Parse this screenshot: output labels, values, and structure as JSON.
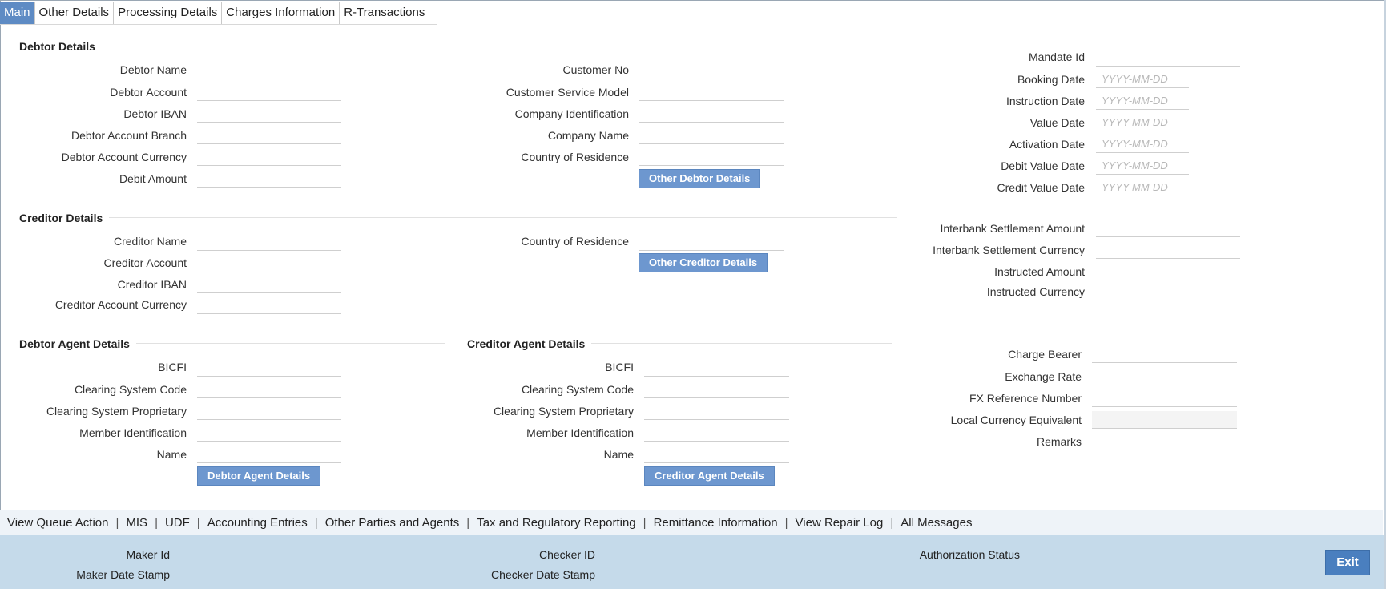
{
  "tabs": [
    "Main",
    "Other Details",
    "Processing Details",
    "Charges Information",
    "R-Transactions"
  ],
  "debtor": {
    "title": "Debtor Details",
    "name": "Debtor Name",
    "account": "Debtor Account",
    "iban": "Debtor IBAN",
    "branch": "Debtor Account Branch",
    "currency": "Debtor Account Currency",
    "amount": "Debit Amount",
    "customer_no": "Customer No",
    "service_model": "Customer Service Model",
    "company_id": "Company Identification",
    "company_name": "Company Name",
    "country": "Country of Residence",
    "other_button": "Other Debtor Details"
  },
  "creditor": {
    "title": "Creditor Details",
    "name": "Creditor Name",
    "account": "Creditor Account",
    "iban": "Creditor IBAN",
    "currency": "Creditor Account Currency",
    "country": "Country of Residence",
    "other_button": "Other Creditor Details"
  },
  "debtor_agent": {
    "title": "Debtor Agent Details",
    "bicfi": "BICFI",
    "clearing_code": "Clearing System Code",
    "clearing_prop": "Clearing System Proprietary",
    "member_id": "Member Identification",
    "name": "Name",
    "button": "Debtor Agent Details"
  },
  "creditor_agent": {
    "title": "Creditor Agent Details",
    "bicfi": "BICFI",
    "clearing_code": "Clearing System Code",
    "clearing_prop": "Clearing System Proprietary",
    "member_id": "Member Identification",
    "name": "Name",
    "button": "Creditor Agent Details"
  },
  "dates": {
    "mandate_id": "Mandate Id",
    "booking_date": "Booking Date",
    "instruction_date": "Instruction Date",
    "value_date": "Value Date",
    "activation_date": "Activation Date",
    "debit_value_date": "Debit Value Date",
    "credit_value_date": "Credit Value Date",
    "placeholder": "YYYY-MM-DD"
  },
  "amounts": {
    "ib_settlement_amount": "Interbank Settlement Amount",
    "ib_settlement_currency": "Interbank Settlement Currency",
    "instructed_amount": "Instructed Amount",
    "instructed_currency": "Instructed Currency"
  },
  "charges": {
    "charge_bearer": "Charge Bearer",
    "exchange_rate": "Exchange Rate",
    "fx_ref": "FX Reference Number",
    "local_equiv": "Local Currency Equivalent",
    "remarks": "Remarks"
  },
  "bottom_nav": [
    "View Queue Action",
    "MIS",
    "UDF",
    "Accounting Entries",
    "Other Parties and Agents",
    "Tax and Regulatory Reporting",
    "Remittance Information",
    "View Repair Log",
    "All Messages"
  ],
  "footer": {
    "maker_id": "Maker Id",
    "maker_date": "Maker Date Stamp",
    "checker_id": "Checker ID",
    "checker_date": "Checker Date Stamp",
    "auth_status": "Authorization Status",
    "exit": "Exit"
  }
}
